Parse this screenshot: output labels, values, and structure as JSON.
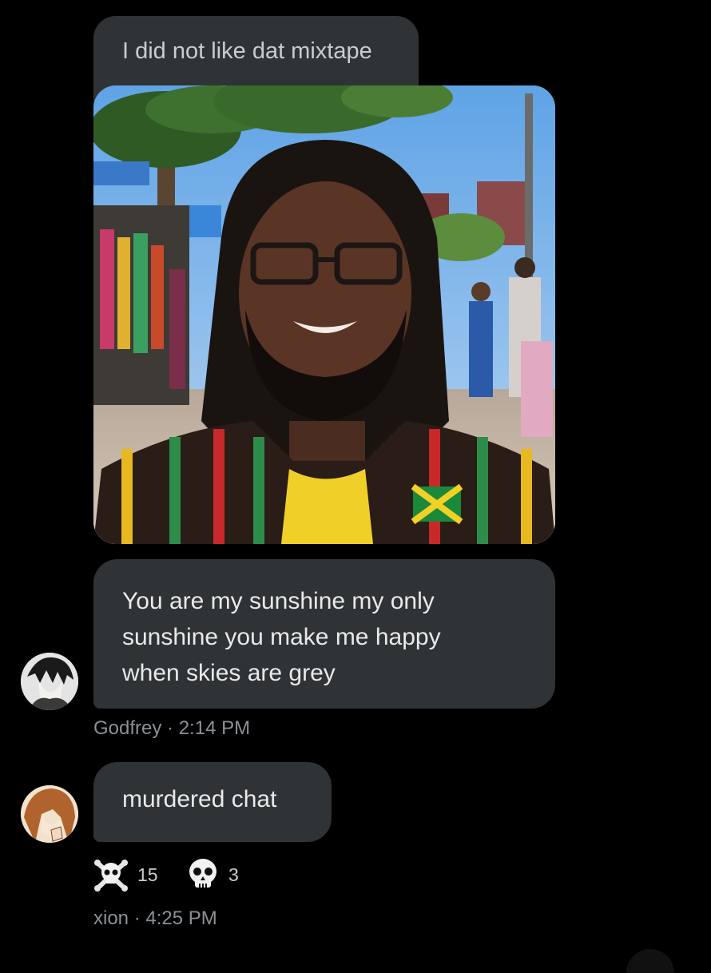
{
  "messages": [
    {
      "text": "I did not like dat mixtape",
      "attachment": "photo of smiling man with dreadlocks, glasses and a beard at a street market"
    },
    {
      "lines": [
        "You are my sunshine my only",
        "sunshine you make me happy",
        "when skies are grey"
      ],
      "author": "Godfrey",
      "time": "2:14 PM"
    },
    {
      "text": "murdered chat",
      "author": "xion",
      "time": "4:25 PM",
      "reactions": [
        {
          "icon": "skull-crossbones-icon",
          "count": "15"
        },
        {
          "icon": "skull-icon",
          "count": "3"
        }
      ]
    }
  ],
  "colors": {
    "background": "#000000",
    "bubble": "#2f3336",
    "meta_text": "#8b9196"
  }
}
